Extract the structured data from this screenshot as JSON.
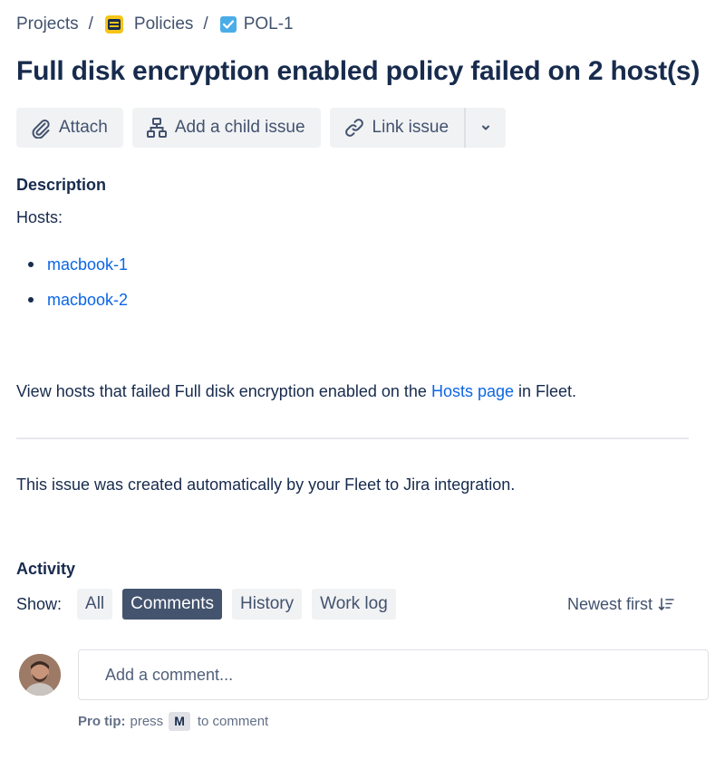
{
  "breadcrumb": {
    "items": [
      {
        "label": "Projects"
      },
      {
        "label": "Policies",
        "icon": "policies-project-icon"
      },
      {
        "label": "POL-1",
        "icon": "checkbox-task-icon"
      }
    ],
    "separator": "/"
  },
  "issue": {
    "title": "Full disk encryption enabled policy failed on 2 host(s)"
  },
  "toolbar": {
    "attach_label": "Attach",
    "child_issue_label": "Add a child issue",
    "link_issue_label": "Link issue"
  },
  "description": {
    "heading": "Description",
    "hosts_label": "Hosts:",
    "hosts": [
      "macbook-1",
      "macbook-2"
    ],
    "view_prefix": "View hosts that failed Full disk encryption enabled on the ",
    "view_link": "Hosts page",
    "view_suffix": " in Fleet.",
    "auto_note": "This issue was created automatically by your Fleet to Jira integration."
  },
  "activity": {
    "heading": "Activity",
    "show_label": "Show:",
    "filters": [
      "All",
      "Comments",
      "History",
      "Work log"
    ],
    "active_filter": "Comments",
    "sort_label": "Newest first",
    "comment_placeholder": "Add a comment...",
    "pro_tip_label": "Pro tip:",
    "pro_tip_before": "press",
    "pro_tip_key": "M",
    "pro_tip_after": "to comment"
  },
  "colors": {
    "text": "#172b4d",
    "subtle": "#42526e",
    "link": "#0c66e4",
    "button_bg": "#f1f2f4",
    "active_filter_bg": "#44546f",
    "policies_icon": "#f5c518",
    "task_icon": "#4bade8"
  }
}
